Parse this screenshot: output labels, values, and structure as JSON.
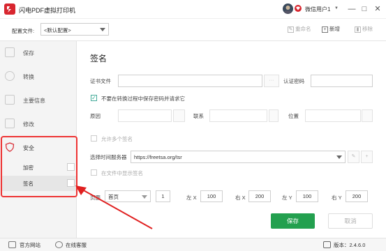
{
  "app": {
    "title": "闪电PDF虚拟打印机"
  },
  "user": {
    "name": "微信用户1",
    "dropdown_arrow": "▼"
  },
  "window_controls": {
    "minimize": "—",
    "maximize": "□",
    "close": "✕"
  },
  "config": {
    "label": "配置文件:",
    "selected": "<默认配置>",
    "actions": [
      {
        "label": "重命名",
        "icon": "rename-icon",
        "enabled": false
      },
      {
        "label": "新增",
        "icon": "plus-icon",
        "enabled": true
      },
      {
        "label": "移除",
        "icon": "trash-icon",
        "enabled": false
      }
    ]
  },
  "sidebar": {
    "items": [
      {
        "label": "保存",
        "icon": "save-icon"
      },
      {
        "label": "转换",
        "icon": "convert-icon"
      },
      {
        "label": "主要信息",
        "icon": "info-icon"
      },
      {
        "label": "修改",
        "icon": "edit-icon"
      },
      {
        "label": "安全",
        "icon": "shield-icon"
      }
    ],
    "security_sub": [
      {
        "label": "加密",
        "checked": false
      },
      {
        "label": "签名",
        "checked": false,
        "selected": true
      }
    ]
  },
  "main": {
    "title": "签名",
    "cert_file_label": "证书文件",
    "cert_file_value": "",
    "browse_label": "···",
    "cert_password_label": "认证密码",
    "cert_password_value": "",
    "dont_ask_password_label": "不要在转换过程中保存密码并请求它",
    "dont_ask_password_checked": true,
    "reason_label": "原因",
    "contact_label": "联系",
    "location_label": "位置",
    "allow_multiple_label": "允许多个签名",
    "allow_multiple_checked": false,
    "timeserver_label": "选择时间服务器",
    "timeserver_value": "https://freetsa.org/tsr",
    "show_in_file_label": "在文件中显示签名",
    "show_in_file_checked": false,
    "page_label": "页面",
    "page_option": "首页",
    "page_number": "1",
    "left_x_label": "左 X",
    "left_x_value": "100",
    "right_x_label": "右 X",
    "right_x_value": "200",
    "left_y_label": "左 Y",
    "left_y_value": "100",
    "right_y_label": "右 Y",
    "right_y_value": "200",
    "save_label": "保存",
    "cancel_label": "取消"
  },
  "footer": {
    "website_label": "官方网站",
    "support_label": "在线客服",
    "version_label": "版本：2.4.6.0"
  },
  "colors": {
    "brand_red": "#d8262f",
    "save_green": "#23a04f",
    "highlight_box": "#ee3333",
    "arrow_red": "#e02020"
  }
}
